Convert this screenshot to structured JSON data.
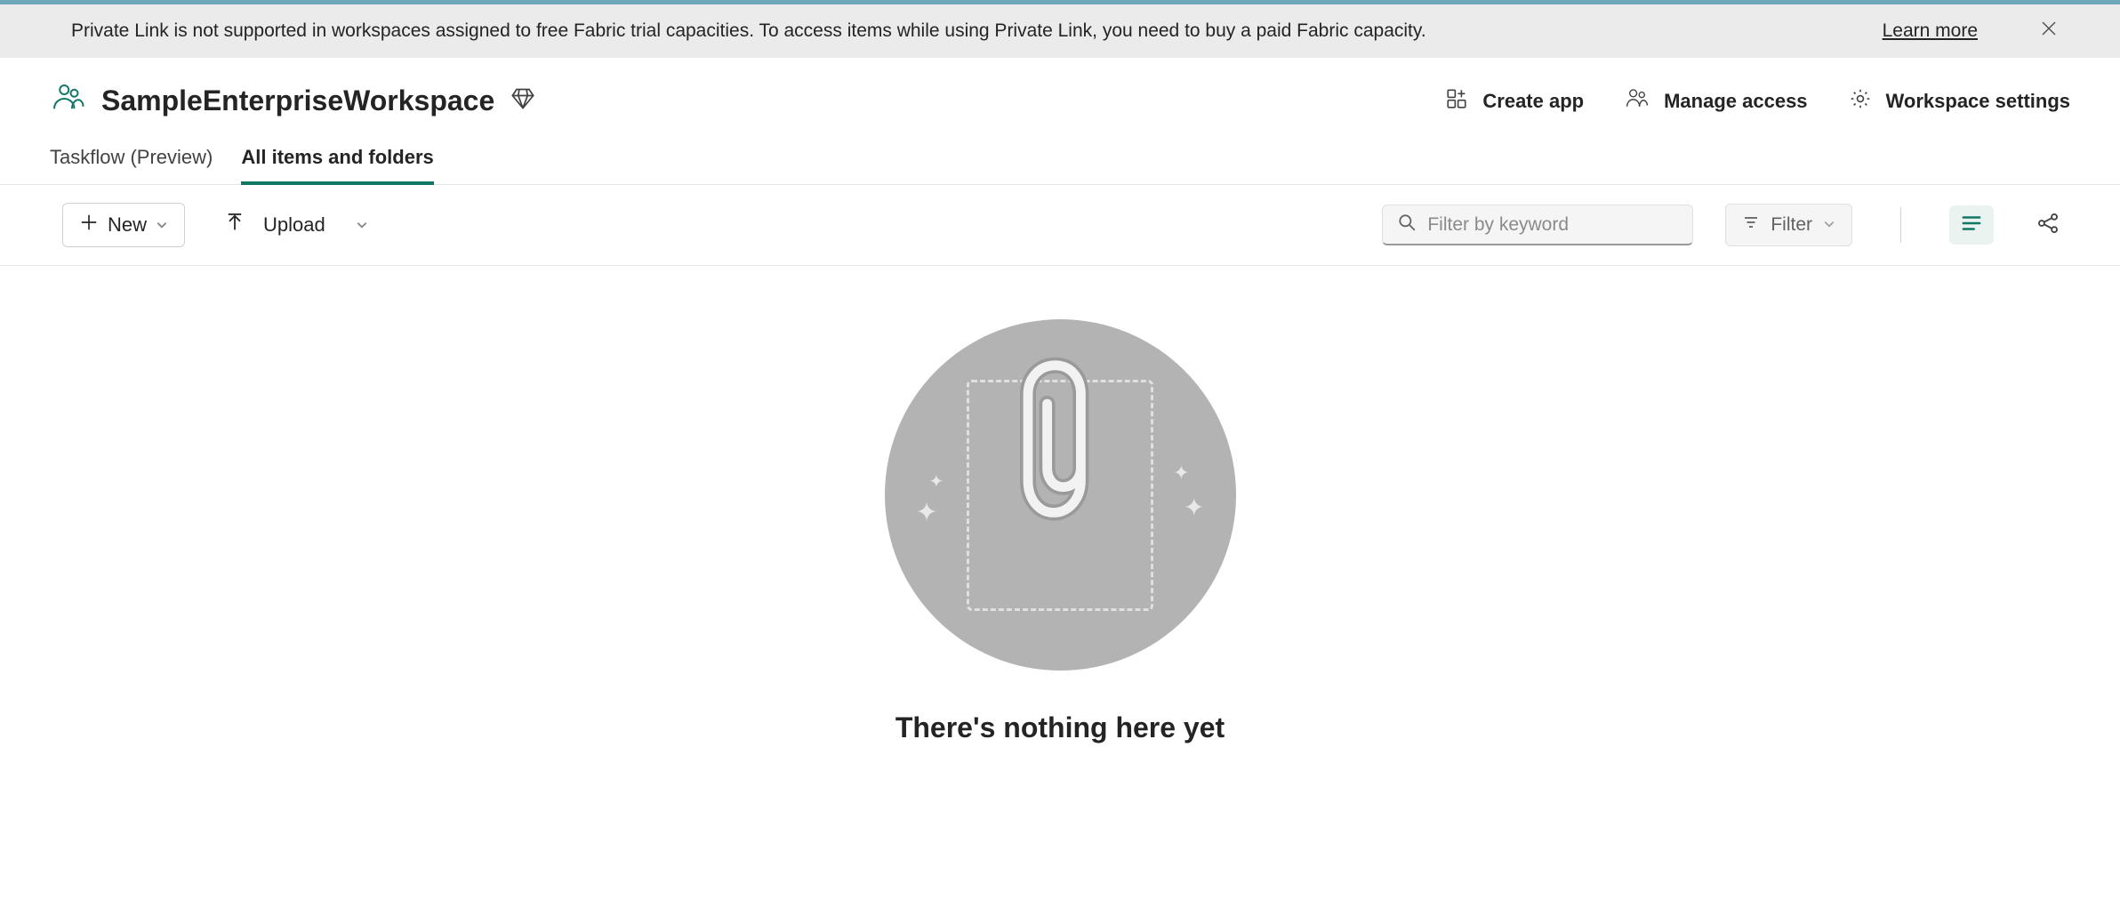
{
  "notification": {
    "text": "Private Link is not supported in workspaces assigned to free Fabric trial capacities. To access items while using Private Link, you need to buy a paid Fabric capacity.",
    "learn_more": "Learn more"
  },
  "workspace": {
    "title": "SampleEnterpriseWorkspace"
  },
  "header_actions": {
    "create_app": "Create app",
    "manage_access": "Manage access",
    "workspace_settings": "Workspace settings"
  },
  "tabs": {
    "taskflow": "Taskflow (Preview)",
    "all_items": "All items and folders"
  },
  "toolbar": {
    "new_label": "New",
    "upload_label": "Upload",
    "filter_placeholder": "Filter by keyword",
    "filter_button": "Filter"
  },
  "empty_state": {
    "title": "There's nothing here yet"
  }
}
